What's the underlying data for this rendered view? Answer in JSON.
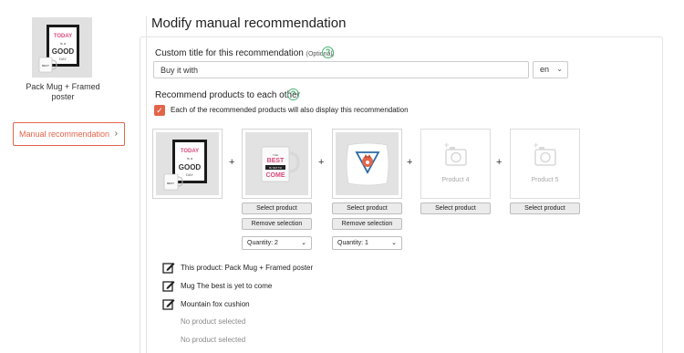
{
  "sidebar": {
    "product_caption": "Pack Mug + Framed poster",
    "manual_recommendation_label": "Manual recommendation"
  },
  "main": {
    "page_title": "Modify manual recommendation",
    "custom_title": {
      "label": "Custom title for this recommendation",
      "optional": "(Optional)",
      "value": "Buy it with",
      "language": "en"
    },
    "recommend": {
      "label": "Recommend products to each other",
      "checkbox_checked": true,
      "checkbox_label": "Each of the recommended products will also display this recommendation"
    },
    "products": [
      {
        "name": "Pack Mug + Framed poster",
        "image": "mug-and-poster"
      },
      {
        "name": "Mug The best is yet to come",
        "image": "mug",
        "select_label": "Select product",
        "remove_label": "Remove selection",
        "quantity_label": "Quantity:",
        "quantity": "2"
      },
      {
        "name": "Mountain fox cushion",
        "image": "cushion",
        "select_label": "Select product",
        "remove_label": "Remove selection",
        "quantity_label": "Quantity:",
        "quantity": "1"
      },
      {
        "placeholder": "Product 4",
        "select_label": "Select product"
      },
      {
        "placeholder": "Product 5",
        "select_label": "Select product"
      }
    ],
    "summary": [
      {
        "text": "This product: Pack Mug + Framed poster"
      },
      {
        "text": "Mug The best is yet to come"
      },
      {
        "text": "Mountain fox cushion"
      }
    ],
    "no_product": [
      "No product selected",
      "No product selected"
    ]
  },
  "colors": {
    "accent": "#e2654a",
    "help": "#4caf75"
  }
}
